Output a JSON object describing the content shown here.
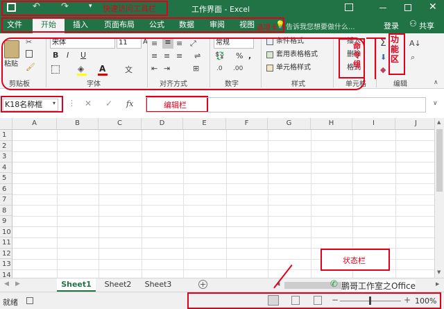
{
  "title_bar": {
    "title": "工作界面 - Excel",
    "annotation": "快速访问工具栏"
  },
  "tabs": [
    "文件",
    "开始",
    "插入",
    "页面布局",
    "公式",
    "数据",
    "审阅",
    "视图"
  ],
  "tab_annotation": "选项卡",
  "tell_me": "告诉我您想要做什么...",
  "login": "登录",
  "share": "共享",
  "ribbon": {
    "clipboard": {
      "paste": "粘贴",
      "label": "剪贴板"
    },
    "font": {
      "name": "宋体",
      "size": "11",
      "bold": "B",
      "italic": "I",
      "underline": "U",
      "label": "字体"
    },
    "alignment": {
      "label": "对齐方式"
    },
    "number": {
      "format": "常规",
      "percent": "%",
      "comma": ",",
      "label": "数字"
    },
    "styles": {
      "conditional": "条件格式",
      "table": "套用表格格式",
      "cell": "单元格样式",
      "label": "样式"
    },
    "cells": {
      "insert": "插入",
      "delete": "删除",
      "format": "格式",
      "label": "单元格",
      "annotation": "命令组"
    },
    "editing": {
      "label": "编辑",
      "annotation": "功能区"
    }
  },
  "formula_bar": {
    "name_box": "K18名称框",
    "fx": "fx",
    "annotation": "编辑栏"
  },
  "columns": [
    "A",
    "B",
    "C",
    "D",
    "E",
    "F",
    "G",
    "H",
    "I",
    "J"
  ],
  "rows": [
    "1",
    "2",
    "3",
    "4",
    "5",
    "6",
    "7",
    "8",
    "9",
    "10",
    "11",
    "12",
    "13",
    "14"
  ],
  "sheets": [
    "Sheet1",
    "Sheet2",
    "Sheet3"
  ],
  "status": {
    "ready": "就绪",
    "annotation": "状态栏",
    "zoom": "100%",
    "watermark": "鹏哥工作室之Office"
  },
  "colors": {
    "accent": "#217346",
    "annotation": "#e0001b"
  }
}
